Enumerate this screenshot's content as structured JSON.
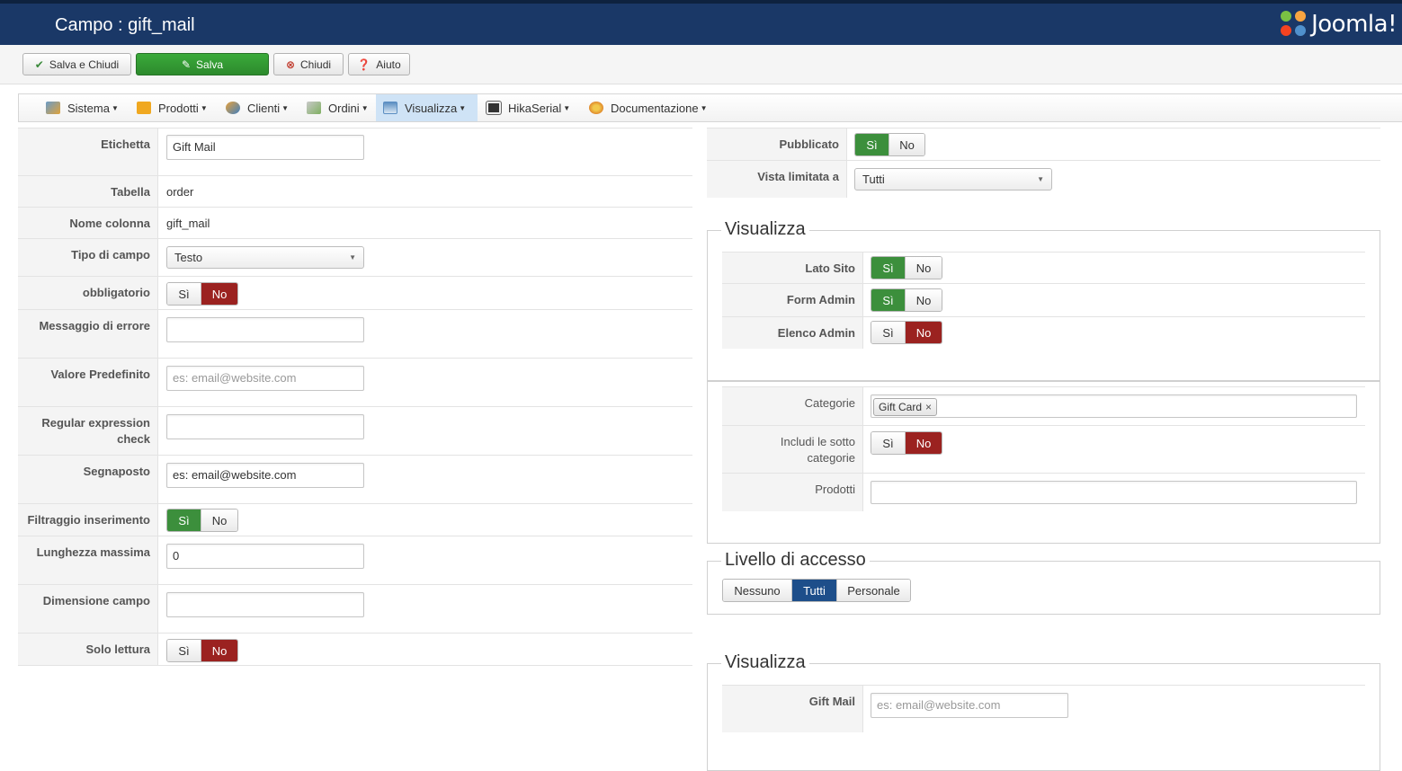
{
  "header": {
    "title": "Campo : gift_mail",
    "logo_text": "Joomla!"
  },
  "toolbar": {
    "save_close": "Salva e Chiudi",
    "save": "Salva",
    "close": "Chiudi",
    "help": "Aiuto"
  },
  "menu": {
    "items": [
      {
        "label": "Sistema",
        "icon": "tools-icon"
      },
      {
        "label": "Prodotti",
        "icon": "box-icon"
      },
      {
        "label": "Clienti",
        "icon": "users-icon"
      },
      {
        "label": "Ordini",
        "icon": "orders-icon"
      },
      {
        "label": "Visualizza",
        "icon": "display-icon"
      },
      {
        "label": "HikaSerial",
        "icon": "serial-icon"
      },
      {
        "label": "Documentazione",
        "icon": "docs-icon"
      }
    ],
    "active": "Visualizza"
  },
  "left": {
    "etichetta": {
      "label": "Etichetta",
      "value": "Gift Mail"
    },
    "tabella": {
      "label": "Tabella",
      "value": "order"
    },
    "nome_colonna": {
      "label": "Nome colonna",
      "value": "gift_mail"
    },
    "tipo_campo": {
      "label": "Tipo di campo",
      "value": "Testo"
    },
    "obbligatorio": {
      "label": "obbligatorio",
      "yes": "Sì",
      "no": "No",
      "selected": "No"
    },
    "messaggio_errore": {
      "label": "Messaggio di errore",
      "value": ""
    },
    "valore_predefinito": {
      "label": "Valore Predefinito",
      "placeholder": "es: email@website.com"
    },
    "regex_check": {
      "label_line1": "Regular expression",
      "label_line2": "check",
      "value": ""
    },
    "segnaposto": {
      "label": "Segnaposto",
      "value": "es: email@website.com"
    },
    "filtraggio": {
      "label": "Filtraggio inserimento",
      "yes": "Sì",
      "no": "No",
      "selected": "Sì"
    },
    "lunghezza_massima": {
      "label": "Lunghezza massima",
      "value": "0"
    },
    "dimensione_campo": {
      "label": "Dimensione campo",
      "value": ""
    },
    "solo_lettura": {
      "label": "Solo lettura",
      "yes": "Sì",
      "no": "No",
      "selected": "No"
    }
  },
  "right": {
    "pubblicato": {
      "label": "Pubblicato",
      "yes": "Sì",
      "no": "No",
      "selected": "Sì"
    },
    "vista_limitata": {
      "label": "Vista limitata a",
      "value": "Tutti"
    },
    "visualizza1": {
      "legend": "Visualizza",
      "lato_sito": {
        "label": "Lato Sito",
        "yes": "Sì",
        "no": "No",
        "selected": "Sì"
      },
      "form_admin": {
        "label": "Form Admin",
        "yes": "Sì",
        "no": "No",
        "selected": "Sì"
      },
      "elenco_admin": {
        "label": "Elenco Admin",
        "yes": "Sì",
        "no": "No",
        "selected": "No"
      }
    },
    "categorie": {
      "label": "Categorie",
      "tag": "Gift Card",
      "tag_remove": "×"
    },
    "includi_sotto": {
      "label_line1": "Includi le sotto",
      "label_line2": "categorie",
      "yes": "Sì",
      "no": "No",
      "selected": "No"
    },
    "prodotti": {
      "label": "Prodotti",
      "value": ""
    },
    "livello_accesso": {
      "legend": "Livello di accesso",
      "options": [
        "Nessuno",
        "Tutti",
        "Personale"
      ],
      "selected": "Tutti"
    },
    "visualizza2": {
      "legend": "Visualizza",
      "gift_mail": {
        "label": "Gift Mail",
        "placeholder": "es: email@website.com"
      }
    }
  },
  "colors": {
    "header_bg": "#1a3867",
    "yes_active": "#3c8f3c",
    "no_active": "#9b2220",
    "blue_active": "#1d4e8a",
    "menu_active": "#cfe3f6"
  }
}
